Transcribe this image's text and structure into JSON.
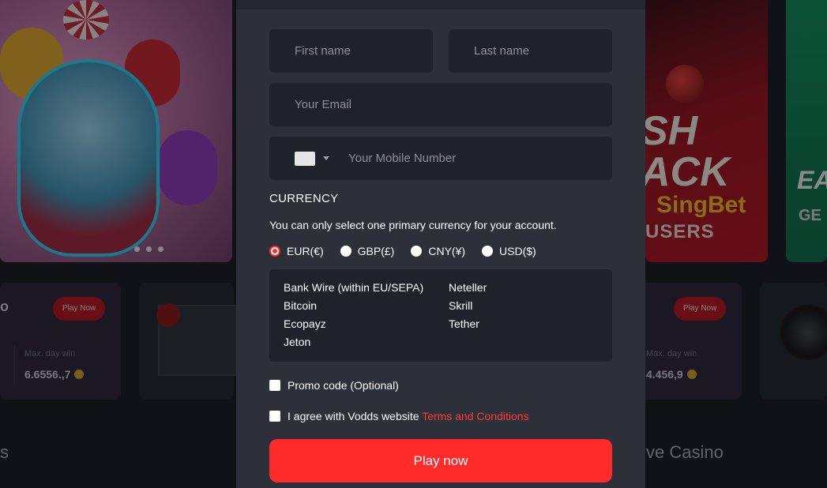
{
  "background": {
    "banner_mid": {
      "big_text": "SH\nACK",
      "brand": "SingBet",
      "users": "USERS"
    },
    "banner_right": {
      "big_text": "EA",
      "sub_text": "GE"
    },
    "cards": [
      {
        "title": "o",
        "play_label": "Play Now",
        "max_label": "Max. day win",
        "amount": "6.6556.,7"
      },
      {
        "play_label": "Play Now",
        "max_label": "Max. day win",
        "amount": "4.456,9"
      }
    ],
    "section_left": "s",
    "section_right": "ve Casino"
  },
  "form": {
    "first_name_placeholder": "First name",
    "last_name_placeholder": "Last name",
    "email_placeholder": "Your Email",
    "mobile_placeholder": "Your Mobile Number",
    "currency_label": "CURRENCY",
    "currency_note": "You can only select one primary currency for your account.",
    "currencies": [
      {
        "label": "EUR(€)",
        "selected": true
      },
      {
        "label": "GBP(£)",
        "selected": false
      },
      {
        "label": "CNY(¥)",
        "selected": false
      },
      {
        "label": "USD($)",
        "selected": false
      }
    ],
    "payment_methods_col1": [
      "Bank Wire (within EU/SEPA)",
      "Bitcoin",
      "Ecopayz",
      "Jeton"
    ],
    "payment_methods_col2": [
      "Neteller",
      "Skrill",
      "Tether"
    ],
    "promo_label": "Promo code (Optional)",
    "terms_prefix": "I agree with Vodds website",
    "terms_link": "Terms and Conditions",
    "submit_label": "Play now"
  },
  "colors": {
    "accent": "#ff2a2a",
    "panel": "#2b3039",
    "field": "#1e222a"
  }
}
